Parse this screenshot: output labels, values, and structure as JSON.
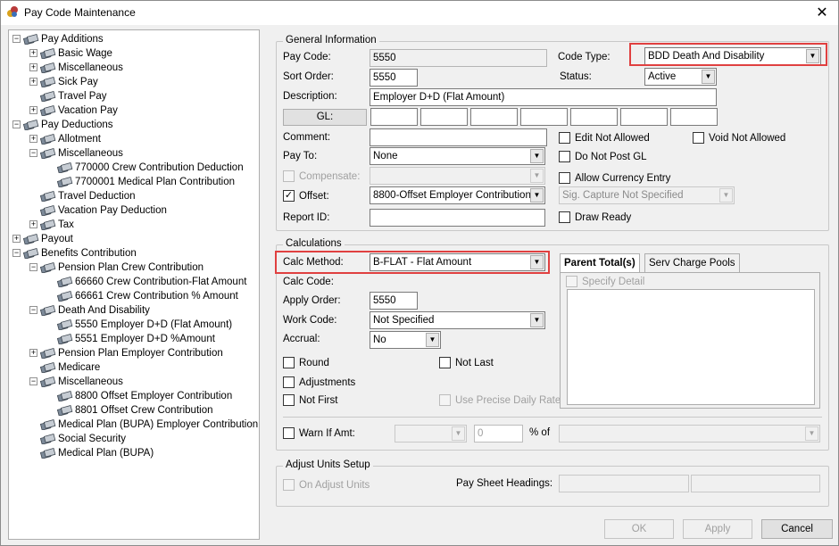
{
  "window": {
    "title": "Pay Code Maintenance",
    "close_glyph": "✕"
  },
  "tree": {
    "nodes": [
      {
        "label": "Pay Additions",
        "expander": "−"
      },
      {
        "label": "Basic Wage",
        "expander": "+"
      },
      {
        "label": "Miscellaneous",
        "expander": "+"
      },
      {
        "label": "Sick Pay",
        "expander": "+"
      },
      {
        "label": "Travel Pay",
        "expander": ""
      },
      {
        "label": "Vacation Pay",
        "expander": "+"
      },
      {
        "label": "Pay Deductions",
        "expander": "−"
      },
      {
        "label": "Allotment",
        "expander": "+"
      },
      {
        "label": "Miscellaneous",
        "expander": "−"
      },
      {
        "label": "770000 Crew Contribution Deduction",
        "expander": ""
      },
      {
        "label": "7700001 Medical Plan Contribution",
        "expander": ""
      },
      {
        "label": "Travel Deduction",
        "expander": ""
      },
      {
        "label": "Vacation Pay Deduction",
        "expander": ""
      },
      {
        "label": "Tax",
        "expander": "+"
      },
      {
        "label": "Payout",
        "expander": "+"
      },
      {
        "label": "Benefits Contribution",
        "expander": "−"
      },
      {
        "label": "Pension Plan Crew Contribution",
        "expander": "−"
      },
      {
        "label": "66660 Crew Contribution-Flat Amount",
        "expander": ""
      },
      {
        "label": "66661 Crew Contribution % Amount",
        "expander": ""
      },
      {
        "label": "Death And Disability",
        "expander": "−"
      },
      {
        "label": "5550 Employer D+D (Flat Amount)",
        "expander": ""
      },
      {
        "label": "5551 Employer D+D %Amount",
        "expander": ""
      },
      {
        "label": "Pension Plan Employer Contribution",
        "expander": "+"
      },
      {
        "label": "Medicare",
        "expander": ""
      },
      {
        "label": "Miscellaneous",
        "expander": "−"
      },
      {
        "label": "8800 Offset Employer Contribution",
        "expander": ""
      },
      {
        "label": "8801 Offset Crew Contribution",
        "expander": ""
      },
      {
        "label": "Medical Plan (BUPA) Employer Contribution",
        "expander": ""
      },
      {
        "label": "Social Security",
        "expander": ""
      },
      {
        "label": "Medical Plan (BUPA)",
        "expander": ""
      }
    ]
  },
  "general": {
    "legend": "General Information",
    "pay_code_label": "Pay Code:",
    "pay_code": "5550",
    "code_type_label": "Code Type:",
    "code_type": "BDD Death And Disability",
    "sort_order_label": "Sort Order:",
    "sort_order": "5550",
    "status_label": "Status:",
    "status": "Active",
    "description_label": "Description:",
    "description": "Employer D+D (Flat Amount)",
    "gl_button": "GL:",
    "comment_label": "Comment:",
    "pay_to_label": "Pay To:",
    "pay_to": "None",
    "compensate_label": "Compensate:",
    "offset_label": "Offset:",
    "offset": "8800-Offset Employer Contribution",
    "report_id_label": "Report ID:",
    "edit_not_allowed": "Edit Not Allowed",
    "void_not_allowed": "Void Not Allowed",
    "do_not_post_gl": "Do Not Post GL",
    "allow_currency_entry": "Allow Currency Entry",
    "sig_capture": "Sig. Capture Not Specified",
    "draw_ready": "Draw Ready"
  },
  "calc": {
    "legend": "Calculations",
    "calc_method_label": "Calc Method:",
    "calc_method": "B-FLAT - Flat Amount",
    "calc_code_label": "Calc Code:",
    "apply_order_label": "Apply Order:",
    "apply_order": "5550",
    "work_code_label": "Work Code:",
    "work_code": "Not Specified",
    "accrual_label": "Accrual:",
    "accrual": "No",
    "round": "Round",
    "not_last": "Not Last",
    "adjustments": "Adjustments",
    "not_first": "Not First",
    "use_precise": "Use Precise Daily Rate",
    "tab_parent": "Parent Total(s)",
    "tab_serv": "Serv Charge Pools",
    "specify_detail": "Specify Detail",
    "warn_if_amt": "Warn If Amt:",
    "warn_value": "0",
    "pct_of": "% of"
  },
  "adjust": {
    "legend": "Adjust Units Setup",
    "on_adjust_units": "On Adjust Units",
    "pay_sheet_headings": "Pay Sheet Headings:"
  },
  "buttons": {
    "ok": "OK",
    "apply": "Apply",
    "cancel": "Cancel"
  },
  "colors": {
    "highlight": "#e04040"
  }
}
